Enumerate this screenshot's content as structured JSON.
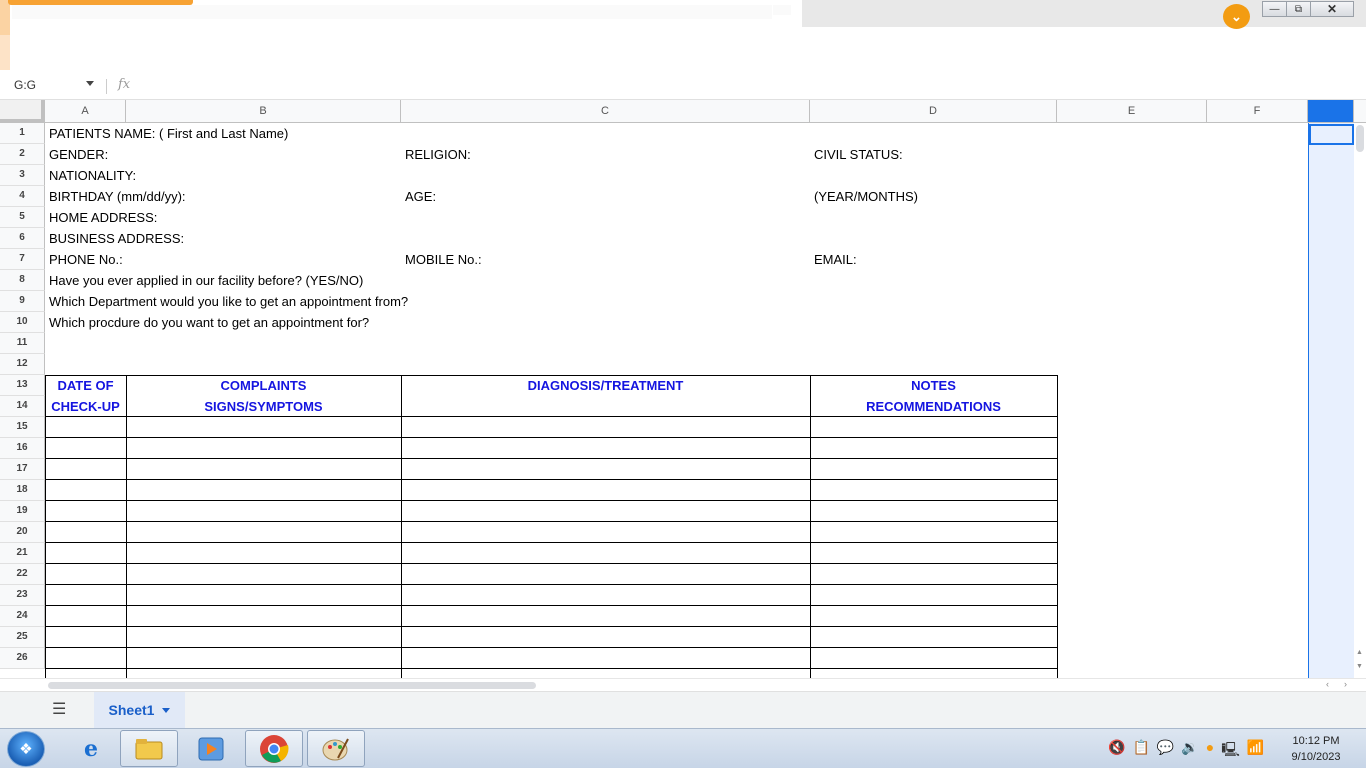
{
  "formula_bar": {
    "name_box": "G:G",
    "fx_label": "fx"
  },
  "columns": [
    "A",
    "B",
    "C",
    "D",
    "E",
    "F"
  ],
  "rows": [
    "1",
    "2",
    "3",
    "4",
    "5",
    "6",
    "7",
    "8",
    "9",
    "10",
    "11",
    "12",
    "13",
    "14",
    "15",
    "16",
    "17",
    "18",
    "19",
    "20",
    "21",
    "22",
    "23",
    "24",
    "25",
    "26"
  ],
  "form": {
    "r1": "PATIENTS NAME: ( First and Last Name)",
    "r2a": "GENDER:",
    "r2c": "RELIGION:",
    "r2d": "CIVIL STATUS:",
    "r3": "NATIONALITY:",
    "r4a": "BIRTHDAY (mm/dd/yy):",
    "r4c": "AGE:",
    "r4d": "(YEAR/MONTHS)",
    "r5": "HOME ADDRESS:",
    "r6": "BUSINESS ADDRESS:",
    "r7a": "PHONE No.:",
    "r7c": "MOBILE No.:",
    "r7d": "EMAIL:",
    "r8": "Have you ever applied in our facility before? (YES/NO)",
    "r9": "Which Department would you like to get an appointment from?",
    "r10": "Which procdure do you want to get an appointment for?"
  },
  "table_headers": {
    "a1": "DATE OF",
    "a2": "CHECK-UP",
    "b1": "COMPLAINTS",
    "b2": "SIGNS/SYMPTOMS",
    "c1": "DIAGNOSIS/TREATMENT",
    "d1": "NOTES",
    "d2": "RECOMMENDATIONS"
  },
  "sheet_tabs": {
    "active": "Sheet1"
  },
  "taskbar": {
    "clock_time": "10:12 PM",
    "clock_date": "9/10/2023"
  },
  "colors": {
    "header_blue": "#1515e0",
    "selection": "#1a73e8",
    "brand_orange": "#f39c12"
  }
}
